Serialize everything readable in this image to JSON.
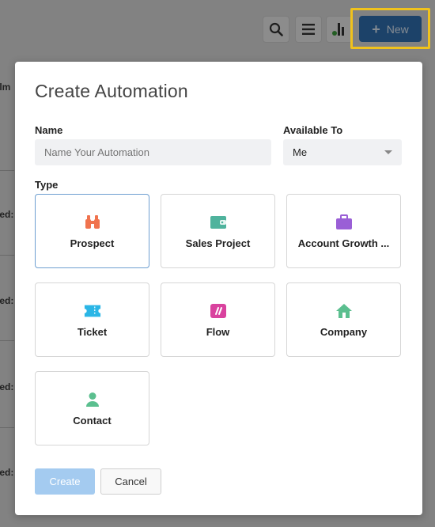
{
  "background": {
    "fragments": [
      "llm",
      "led:",
      "led:",
      "led: (",
      "led:"
    ]
  },
  "toolbar": {
    "search_icon": "search-icon",
    "menu_icon": "menu-icon",
    "chart_icon": "bar-chart-icon",
    "new_label": "New"
  },
  "modal": {
    "title": "Create Automation",
    "name_label": "Name",
    "name_placeholder": "Name Your Automation",
    "available_label": "Available To",
    "available_value": "Me",
    "type_label": "Type",
    "types": [
      {
        "label": "Prospect",
        "icon": "binoculars-icon",
        "color": "#f0734e",
        "selected": true
      },
      {
        "label": "Sales Project",
        "icon": "wallet-icon",
        "color": "#4fb39d",
        "selected": false
      },
      {
        "label": "Account Growth ...",
        "icon": "briefcase-icon",
        "color": "#9a5fd6",
        "selected": false
      },
      {
        "label": "Ticket",
        "icon": "ticket-icon",
        "color": "#2bb6e6",
        "selected": false
      },
      {
        "label": "Flow",
        "icon": "flow-icon",
        "color": "#d9429e",
        "selected": false
      },
      {
        "label": "Company",
        "icon": "house-icon",
        "color": "#5bbf8f",
        "selected": false
      },
      {
        "label": "Contact",
        "icon": "person-icon",
        "color": "#5bbf8f",
        "selected": false
      }
    ],
    "create_label": "Create",
    "cancel_label": "Cancel"
  }
}
